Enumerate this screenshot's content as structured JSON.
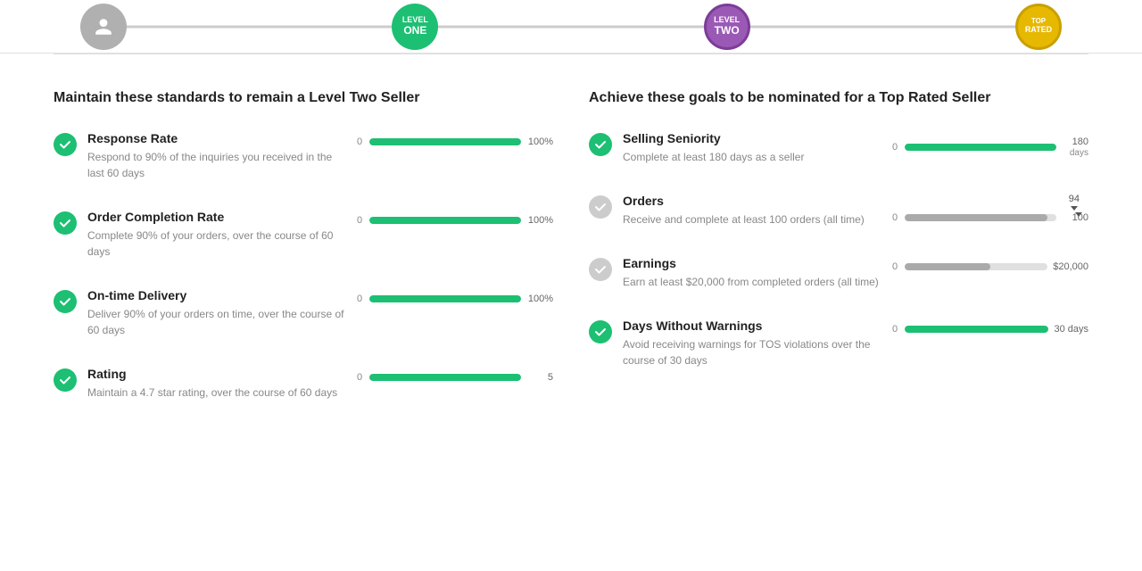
{
  "topBar": {
    "steps": [
      {
        "id": "step-icon",
        "style": "gray",
        "lines": [
          "",
          ""
        ]
      },
      {
        "id": "step-one",
        "style": "teal",
        "lines": [
          "LEVEL",
          "ONE"
        ]
      },
      {
        "id": "step-two",
        "style": "purple",
        "lines": [
          "LEVEL",
          "TWO"
        ]
      },
      {
        "id": "step-rated",
        "style": "gold",
        "lines": [
          "TOP",
          "RATED"
        ]
      }
    ]
  },
  "leftColumn": {
    "title": "Maintain these standards to remain a Level Two Seller",
    "metrics": [
      {
        "name": "Response Rate",
        "desc": "Respond to 90% of the inquiries you received in the last 60 days",
        "iconStyle": "green",
        "barStyle": "green",
        "barPercent": 100,
        "barStart": "0",
        "barEnd": "100%"
      },
      {
        "name": "Order Completion Rate",
        "desc": "Complete 90% of your orders, over the course of 60 days",
        "iconStyle": "green",
        "barStyle": "green",
        "barPercent": 100,
        "barStart": "0",
        "barEnd": "100%"
      },
      {
        "name": "On-time Delivery",
        "desc": "Deliver 90% of your orders on time, over the course of 60 days",
        "iconStyle": "green",
        "barStyle": "green",
        "barPercent": 100,
        "barStart": "0",
        "barEnd": "100%"
      },
      {
        "name": "Rating",
        "desc": "Maintain a 4.7 star rating, over the course of 60 days",
        "iconStyle": "green",
        "barStyle": "green",
        "barPercent": 100,
        "barStart": "0",
        "barEnd": "5"
      }
    ]
  },
  "rightColumn": {
    "title": "Achieve these goals to be nominated for a Top Rated Seller",
    "metrics": [
      {
        "name": "Selling Seniority",
        "desc": "Complete at least 180 days as a seller",
        "iconStyle": "green",
        "barStyle": "green",
        "barPercent": 100,
        "barStart": "0",
        "barEnd": "180",
        "barEndSuffix": " days",
        "hasTooltip": false
      },
      {
        "name": "Orders",
        "desc": "Receive and complete at least 100 orders (all time)",
        "iconStyle": "gray",
        "barStyle": "gray",
        "barPercent": 94,
        "barStart": "0",
        "barEnd": "100",
        "barEndSuffix": "",
        "hasTooltip": true,
        "tooltipValue": "94"
      },
      {
        "name": "Earnings",
        "desc": "Earn at least $20,000 from completed orders (all time)",
        "iconStyle": "gray",
        "barStyle": "gray",
        "barPercent": 60,
        "barStart": "0",
        "barEnd": "$20,000",
        "barEndSuffix": "",
        "hasTooltip": false
      },
      {
        "name": "Days Without Warnings",
        "desc": "Avoid receiving warnings for TOS violations over the course of 30 days",
        "iconStyle": "green",
        "barStyle": "green",
        "barPercent": 100,
        "barStart": "0",
        "barEnd": "30 days",
        "barEndSuffix": "",
        "hasTooltip": false
      }
    ]
  }
}
